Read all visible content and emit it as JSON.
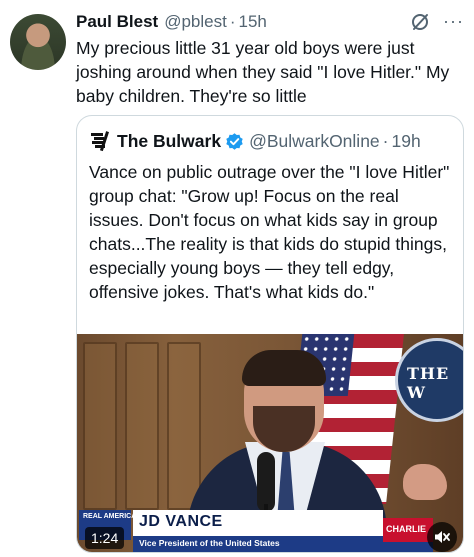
{
  "tweet": {
    "author_name": "Paul Blest",
    "author_handle": "@pblest",
    "separator": "·",
    "time": "15h",
    "text": "My precious little 31 year old boys were just joshing around when they said \"I love Hitler.\" My baby children. They're so little",
    "more_label": "···"
  },
  "quote": {
    "author_name": "The Bulwark",
    "author_handle": "@BulwarkOnline",
    "separator": "·",
    "time": "19h",
    "text": "Vance on public outrage over the \"I love Hitler\" group chat: \"Grow up! Focus on the real issues. Don't focus on what kids say in group chats...The reality is that kids do stupid things, especially young boys — they tell edgy, offensive jokes. That's what kids do.\""
  },
  "video": {
    "timer": "1:24",
    "lower_third_name": "JD VANCE",
    "lower_third_title": "Vice President of the United States",
    "network_logo_text": "REAL AMERICA'S",
    "side_logo_text": "CHARLIE",
    "seal_text": "THE W"
  },
  "colors": {
    "text_primary": "#0f1419",
    "text_secondary": "#536471",
    "border": "#cfd9de",
    "verified_badge": "#1d9bf0"
  },
  "icons": {
    "grok": "grok-icon",
    "more": "more-icon",
    "verified": "verified-badge-icon",
    "mute": "speaker-muted-icon"
  }
}
